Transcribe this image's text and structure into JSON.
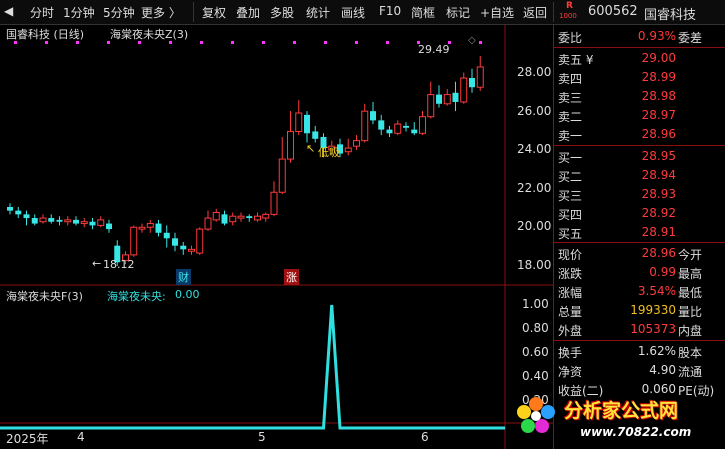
{
  "toolbar": {
    "items": [
      "分时",
      "1分钟",
      "5分钟",
      "更多 〉",
      "复权",
      "叠加",
      "多股",
      "统计",
      "画线",
      "F10",
      "简框",
      "标记",
      "+自选",
      "返回"
    ]
  },
  "header": {
    "exchange_badge": "R",
    "exchange_badge_sub": "1000",
    "code": "600562",
    "name": "国睿科技"
  },
  "main_panel": {
    "title": "国睿科技 (日线)",
    "indicator": "海棠夜未央Z(3)",
    "max_label": "29.49",
    "min_label": "18.12",
    "low_annotation": "低吸",
    "events": [
      "财",
      "涨"
    ],
    "y_ticks": [
      "28.00",
      "26.00",
      "24.00",
      "22.00",
      "20.00",
      "18.00"
    ]
  },
  "sub_panel": {
    "title": "海棠夜未央F(3)",
    "value_label": "海棠夜未央:",
    "value": "0.00",
    "y_ticks": [
      "1.00",
      "0.80",
      "0.60",
      "0.40",
      "0.20"
    ]
  },
  "x_axis": {
    "labels": [
      "2025年",
      "4",
      "5",
      "6"
    ]
  },
  "quote": {
    "weibi": {
      "label": "委比",
      "value": "0.93%",
      "extra": "委差"
    },
    "sells": [
      {
        "label": "卖五 ¥",
        "price": "29.00"
      },
      {
        "label": "卖四",
        "price": "28.99"
      },
      {
        "label": "卖三",
        "price": "28.98"
      },
      {
        "label": "卖二",
        "price": "28.97"
      },
      {
        "label": "卖一",
        "price": "28.96"
      }
    ],
    "buys": [
      {
        "label": "买一",
        "price": "28.95"
      },
      {
        "label": "买二",
        "price": "28.94"
      },
      {
        "label": "买三",
        "price": "28.93"
      },
      {
        "label": "买四",
        "price": "28.92"
      },
      {
        "label": "买五",
        "price": "28.91"
      }
    ],
    "stats": [
      {
        "label": "现价",
        "value": "28.96",
        "extra": "今开",
        "color": "#ff3b3b"
      },
      {
        "label": "涨跌",
        "value": "0.99",
        "extra": "最高",
        "color": "#ff3b3b"
      },
      {
        "label": "涨幅",
        "value": "3.54%",
        "extra": "最低",
        "color": "#ff3b3b"
      },
      {
        "label": "总量",
        "value": "199330",
        "extra": "量比",
        "color": "#f0c020"
      },
      {
        "label": "外盘",
        "value": "105373",
        "extra": "内盘",
        "color": "#ff3b3b"
      }
    ],
    "stats2": [
      {
        "label": "换手",
        "value": "1.62%",
        "extra": "股本"
      },
      {
        "label": "净资",
        "value": "4.90",
        "extra": "流通"
      },
      {
        "label": "收益(二)",
        "value": "0.060",
        "extra": "PE(动)"
      }
    ]
  },
  "watermark": {
    "title": "分析家公式网",
    "url": "www.70822.com"
  },
  "colors": {
    "up": "#ff3b3b",
    "down": "#39e6e6",
    "signal": "#30e0e0",
    "magenta": "#ff33ff"
  },
  "chart_data": {
    "type": "candlestick",
    "price_range": [
      17.5,
      30.2
    ],
    "candles": [
      [
        21.3,
        21.1,
        21.5,
        20.9
      ],
      [
        21.1,
        20.9,
        21.3,
        20.7
      ],
      [
        20.9,
        20.7,
        21.1,
        20.3
      ],
      [
        20.7,
        20.4,
        20.9,
        20.3
      ],
      [
        20.5,
        20.7,
        20.9,
        20.4
      ],
      [
        20.7,
        20.5,
        20.9,
        20.4
      ],
      [
        20.6,
        20.5,
        20.8,
        20.3
      ],
      [
        20.5,
        20.6,
        20.8,
        20.3
      ],
      [
        20.6,
        20.4,
        20.8,
        20.3
      ],
      [
        20.4,
        20.5,
        20.7,
        20.2
      ],
      [
        20.5,
        20.3,
        20.7,
        20.1
      ],
      [
        20.3,
        20.6,
        20.8,
        20.2
      ],
      [
        20.4,
        20.1,
        20.6,
        19.9
      ],
      [
        19.2,
        18.3,
        19.5,
        18.1
      ],
      [
        18.4,
        18.7,
        18.9,
        18.2
      ],
      [
        18.7,
        20.2,
        20.3,
        18.6
      ],
      [
        20.1,
        20.2,
        20.4,
        19.9
      ],
      [
        20.2,
        20.4,
        20.6,
        19.9
      ],
      [
        20.4,
        19.9,
        20.6,
        19.7
      ],
      [
        19.9,
        19.6,
        20.3,
        19.1
      ],
      [
        19.6,
        19.2,
        19.9,
        18.9
      ],
      [
        19.2,
        19.0,
        19.4,
        18.7
      ],
      [
        18.9,
        19.0,
        19.2,
        18.7
      ],
      [
        18.8,
        20.1,
        20.2,
        18.7
      ],
      [
        20.1,
        20.7,
        21.1,
        20.0
      ],
      [
        20.6,
        21.0,
        21.2,
        20.5
      ],
      [
        20.9,
        20.4,
        21.1,
        20.3
      ],
      [
        20.5,
        20.8,
        21.0,
        20.3
      ],
      [
        20.7,
        20.8,
        21.0,
        20.5
      ],
      [
        20.8,
        20.7,
        20.9,
        20.5
      ],
      [
        20.6,
        20.8,
        21.0,
        20.5
      ],
      [
        20.7,
        20.9,
        21.0,
        20.5
      ],
      [
        20.9,
        22.1,
        22.7,
        20.8
      ],
      [
        22.1,
        23.9,
        25.1,
        22.0
      ],
      [
        23.9,
        25.4,
        26.5,
        23.7
      ],
      [
        25.4,
        26.4,
        27.1,
        25.2
      ],
      [
        26.3,
        25.3,
        26.5,
        24.8
      ],
      [
        25.4,
        25.0,
        25.7,
        24.8
      ],
      [
        25.1,
        24.5,
        25.3,
        24.0
      ],
      [
        24.4,
        24.6,
        24.9,
        24.1
      ],
      [
        24.7,
        24.2,
        25.0,
        24.0
      ],
      [
        24.3,
        24.5,
        25.0,
        24.1
      ],
      [
        24.6,
        24.9,
        25.2,
        24.4
      ],
      [
        24.9,
        26.5,
        26.9,
        24.8
      ],
      [
        26.5,
        26.0,
        27.0,
        25.8
      ],
      [
        26.0,
        25.5,
        26.3,
        25.2
      ],
      [
        25.5,
        25.3,
        25.7,
        25.1
      ],
      [
        25.3,
        25.8,
        26.0,
        25.2
      ],
      [
        25.7,
        25.6,
        25.9,
        25.4
      ],
      [
        25.5,
        25.3,
        25.9,
        25.2
      ],
      [
        25.3,
        26.2,
        26.5,
        25.2
      ],
      [
        26.2,
        27.4,
        28.1,
        26.1
      ],
      [
        27.4,
        26.9,
        27.9,
        26.7
      ],
      [
        26.9,
        27.4,
        27.7,
        26.8
      ],
      [
        27.5,
        27.0,
        28.1,
        26.5
      ],
      [
        27.0,
        28.3,
        28.6,
        26.9
      ],
      [
        28.3,
        27.8,
        28.8,
        27.5
      ],
      [
        27.8,
        28.9,
        29.5,
        27.6
      ]
    ],
    "signal_values": [
      0,
      0,
      0,
      0,
      0,
      0,
      0,
      0,
      0,
      0,
      0,
      0,
      0,
      0,
      0,
      0,
      0,
      0,
      0,
      0,
      0,
      0,
      0,
      0,
      0,
      0,
      0,
      0,
      0,
      0,
      0,
      0,
      0,
      0,
      0,
      0,
      0,
      0,
      0,
      1,
      0,
      0,
      0,
      0,
      0,
      0,
      0,
      0,
      0,
      0,
      0,
      0,
      0,
      0,
      0,
      0,
      0,
      0
    ],
    "signal_range": [
      0,
      1
    ]
  }
}
